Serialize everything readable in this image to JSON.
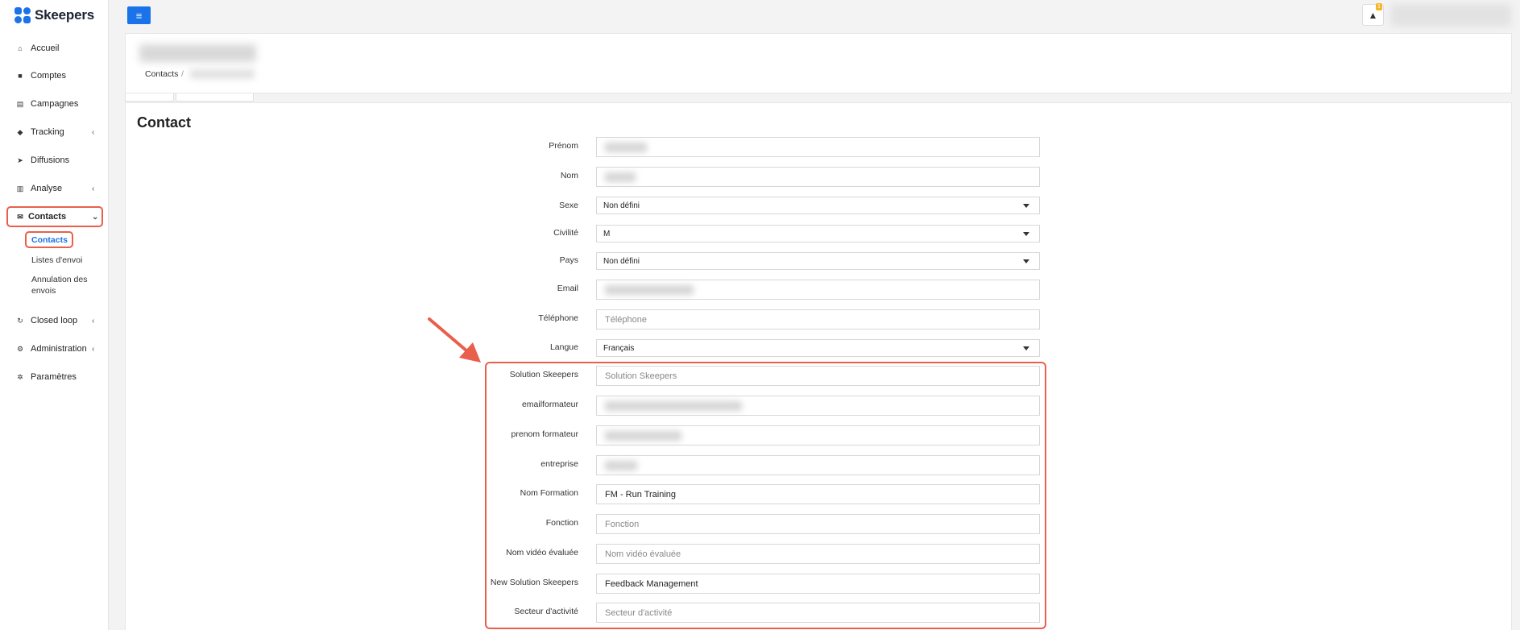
{
  "app": {
    "name": "Skeepers"
  },
  "sidebar": {
    "items": [
      {
        "label": "Accueil",
        "icon": "home-icon",
        "glyph": "⌂",
        "chevron": ""
      },
      {
        "label": "Comptes",
        "icon": "users-icon",
        "glyph": "👥",
        "chevron": ""
      },
      {
        "label": "Campagnes",
        "icon": "file-icon",
        "glyph": "▤",
        "chevron": ""
      },
      {
        "label": "Tracking",
        "icon": "tag-icon",
        "glyph": "◆",
        "chevron": "‹"
      },
      {
        "label": "Diffusions",
        "icon": "rocket-icon",
        "glyph": "➤",
        "chevron": ""
      },
      {
        "label": "Analyse",
        "icon": "bar-chart-icon",
        "glyph": "▥",
        "chevron": "‹"
      },
      {
        "label": "Contacts",
        "icon": "envelope-icon",
        "glyph": "✉",
        "chevron": "⌄"
      },
      {
        "label": "Closed loop",
        "icon": "refresh-icon",
        "glyph": "↻",
        "chevron": "‹"
      },
      {
        "label": "Administration",
        "icon": "cogs-icon",
        "glyph": "⚙",
        "chevron": "‹"
      },
      {
        "label": "Paramètres",
        "icon": "gear-icon",
        "glyph": "✲",
        "chevron": ""
      }
    ],
    "contacts_sub": {
      "contacts": "Contacts",
      "listes": "Listes d'envoi",
      "annulation_line1": "Annulation des",
      "annulation_line2": "envois"
    }
  },
  "topbar": {
    "menu_icon": "≡",
    "bell_icon": "🔔",
    "bell_badge": "1"
  },
  "breadcrumb": {
    "root": "Contacts",
    "sep": "/"
  },
  "form": {
    "title": "Contact",
    "labels": {
      "prenom": "Prénom",
      "nom": "Nom",
      "sexe": "Sexe",
      "civilite": "Civilité",
      "pays": "Pays",
      "email": "Email",
      "telephone": "Téléphone",
      "langue": "Langue",
      "solution": "Solution Skeepers",
      "emailformateur": "emailformateur",
      "prenom_formateur": "prenom formateur",
      "entreprise": "entreprise",
      "nom_formation": "Nom Formation",
      "fonction": "Fonction",
      "nom_video": "Nom vidéo évaluée",
      "new_solution": "New Solution Skeepers",
      "secteur": "Secteur d'activité"
    },
    "values": {
      "sexe": "Non défini",
      "civilite": "M",
      "pays": "Non défini",
      "langue": "Français",
      "nom_formation": "FM - Run Training",
      "new_solution": "Feedback Management"
    },
    "placeholders": {
      "telephone": "Téléphone",
      "solution": "Solution Skeepers",
      "fonction": "Fonction",
      "nom_video": "Nom vidéo évaluée",
      "secteur": "Secteur d'activité"
    }
  },
  "colors": {
    "accent": "#1a73e8",
    "highlight": "#e8604c",
    "badge": "#f5b728"
  }
}
